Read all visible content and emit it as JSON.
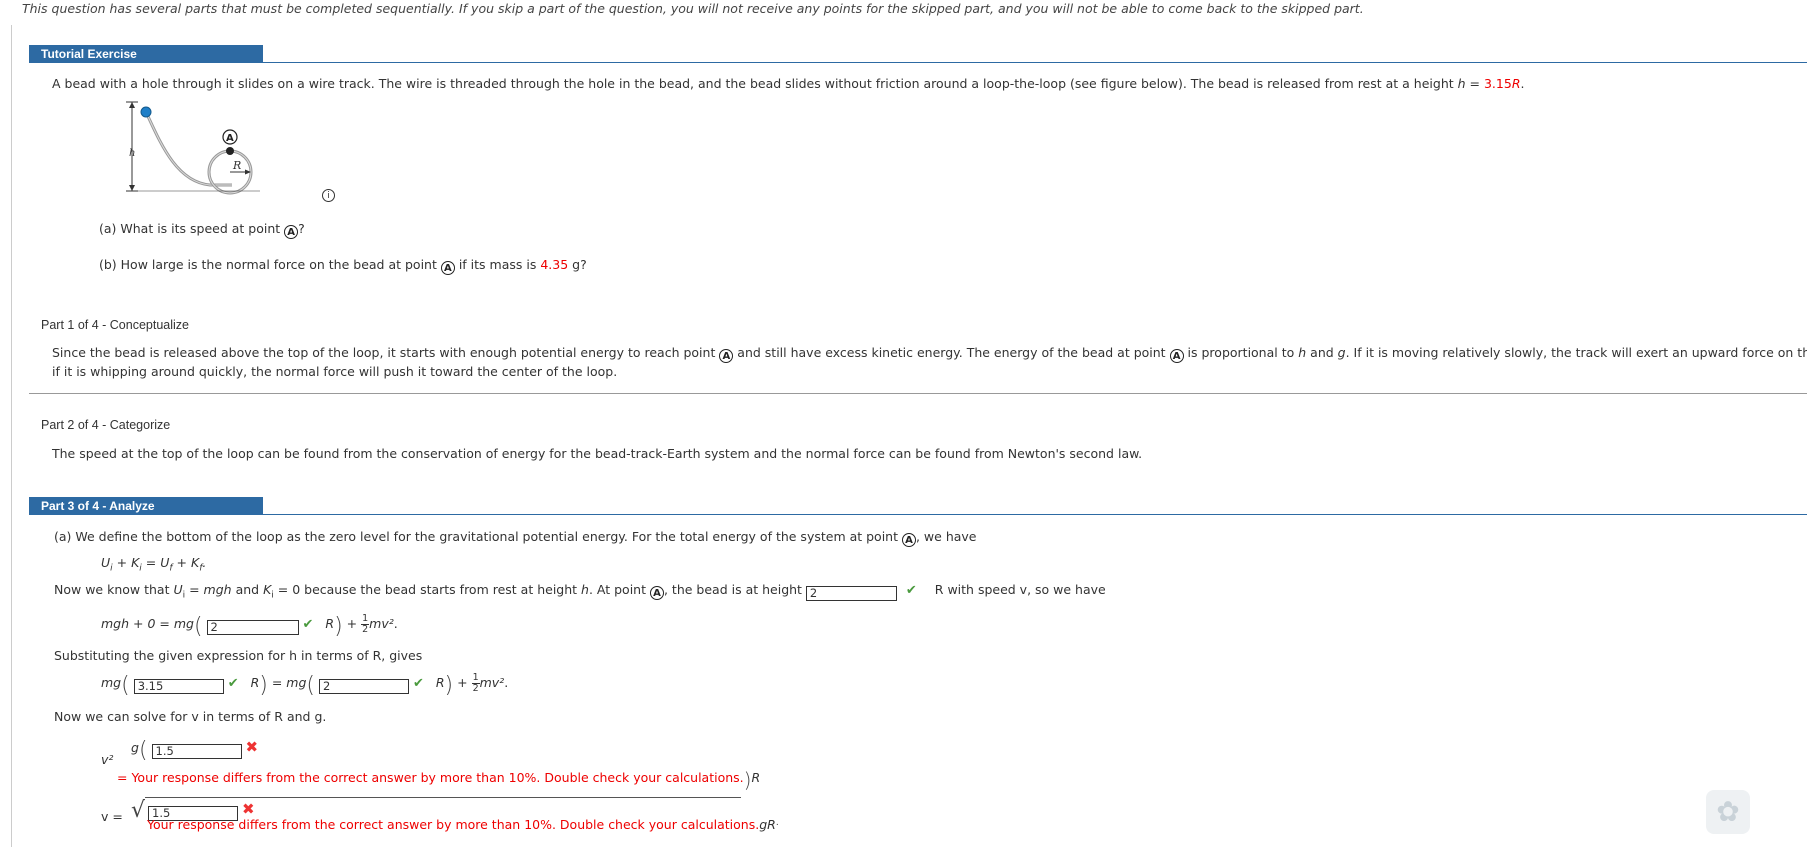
{
  "notice": "This question has several parts that must be completed sequentially. If you skip a part of the question, you will not receive any points for the skipped part, and you will not be able to come back to the skipped part.",
  "tutorial": {
    "header": "Tutorial Exercise",
    "intro": "A bead with a hole through it slides on a wire track. The wire is threaded through the hole in the bead, and the bead slides without friction around a loop-the-loop (see figure below). The bead is released from rest at a height ",
    "intro_h": "h",
    "intro_eq": " = ",
    "h_value": "3.15",
    "h_unit": "R",
    "intro_end": ".",
    "figure": {
      "label_h": "h",
      "label_R": "R",
      "label_A": "A"
    },
    "qa_prefix": "(a) What is its speed at point ",
    "qa_suffix": "?",
    "qb_prefix": "(b) How large is the normal force on the bead at point ",
    "qb_mid": " if its mass is ",
    "qb_mass": "4.35",
    "qb_suffix": " g?"
  },
  "part1": {
    "label": "Part 1 of 4 - Conceptualize",
    "text1_a": "Since the bead is released above the top of the loop, it starts with enough potential energy to reach point ",
    "text1_b": " and still have excess kinetic energy. The energy of the bead at point ",
    "text1_c": " is proportional to ",
    "text1_h": "h",
    "text1_and": " and ",
    "text1_g": "g",
    "text1_d": ". If it is moving relatively slowly, the track will exert an upward force on the bead, but",
    "text2": "if it is whipping around quickly, the normal force will push it toward the center of the loop."
  },
  "part2": {
    "label": "Part 2 of 4 - Categorize",
    "text": "The speed at the top of the loop can be found from the conservation of energy for the bead-track-Earth system and the normal force can be found from Newton's second law."
  },
  "part3": {
    "header": "Part 3 of 4 - Analyze",
    "line_a_prefix": "(a) We define the bottom of the loop as the zero level for the gravitational potential energy. For the total energy of the system at point ",
    "line_a_suffix": ", we have",
    "energy_eq": "U_i + K_i = U_f + K_f.",
    "know_prefix": "Now we know that ",
    "know_1": "U",
    "know_2": " = ",
    "know_3": "mgh",
    "know_4": " and ",
    "know_5": "K",
    "know_6": " = 0 because the bead starts from rest at height ",
    "know_7": "h",
    "know_8": ". At point ",
    "know_9": ", the bead is at height ",
    "height_value": "2",
    "know_after": "R with speed v, so we have",
    "eq1_left": "mgh + 0 = mg",
    "eq1_value": "2",
    "eq1_right": "R",
    "frac_num": "1",
    "frac_den": "2",
    "mv2": "mv²",
    "subst_label": "Substituting the given expression for h in terms of R, gives",
    "eq2_mg": "mg",
    "eq2_value1": "3.15",
    "eq2_R": "R",
    "eq2_mid": "= mg",
    "eq2_value2": "2",
    "solve_label": "Now we can solve for v in terms of R and g.",
    "v2_label": "v²",
    "v2_g": "g",
    "v2_value": "1.5",
    "v2_error": "= Your response differs from the correct answer by more than 10%. Double check your calculations.",
    "v2_R": "R",
    "v_label": "v  =",
    "v_value": "1.5",
    "v_error": "Your response differs from the correct answer by more than 10%. Double check your calculations.",
    "v_gR": "gR"
  }
}
